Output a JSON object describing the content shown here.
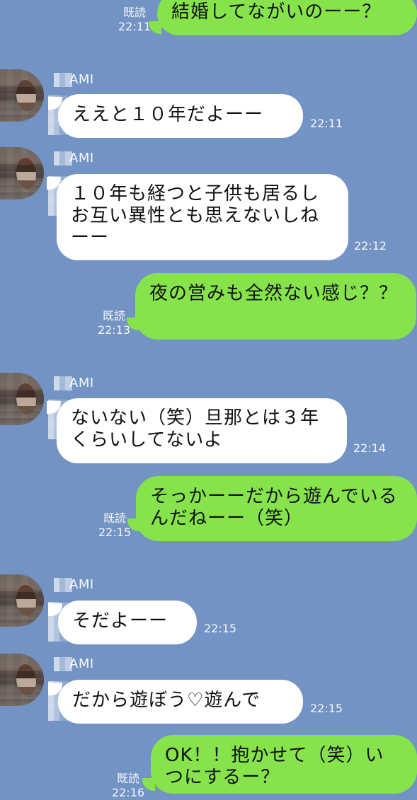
{
  "messages": [
    {
      "direction": "outgoing",
      "text": "結婚してながいのーー？",
      "read": "既読",
      "time": "22:11"
    },
    {
      "direction": "incoming",
      "name": "AMI",
      "text": "ええと１０年だよーー",
      "time": "22:11"
    },
    {
      "direction": "incoming",
      "name": "AMI",
      "text": "１０年も経つと子供も居るしお互い異性とも思えないしねーー",
      "time": "22:12"
    },
    {
      "direction": "outgoing",
      "text": "夜の営みも全然ない感じ？？",
      "read": "既読",
      "time": "22:13"
    },
    {
      "direction": "incoming",
      "name": "AMI",
      "text": "ないない（笑）旦那とは３年くらいしてないよ",
      "time": "22:14"
    },
    {
      "direction": "outgoing",
      "text": "そっかーーだから遊んでいるんだねーー（笑）",
      "read": "既読",
      "time": "22:15"
    },
    {
      "direction": "incoming",
      "name": "AMI",
      "text": "そだよーー",
      "time": "22:15"
    },
    {
      "direction": "incoming",
      "name": "AMI",
      "text": "だから遊ぼう♡遊んで",
      "time": "22:15"
    },
    {
      "direction": "outgoing",
      "text": "OK！！抱かせて（笑）いつにするー？",
      "read": "既読",
      "time": "22:16"
    }
  ],
  "colors": {
    "background": "#7293c3",
    "incoming_bubble": "#ffffff",
    "outgoing_bubble": "#86e34c",
    "meta_text": "#ffffff"
  }
}
